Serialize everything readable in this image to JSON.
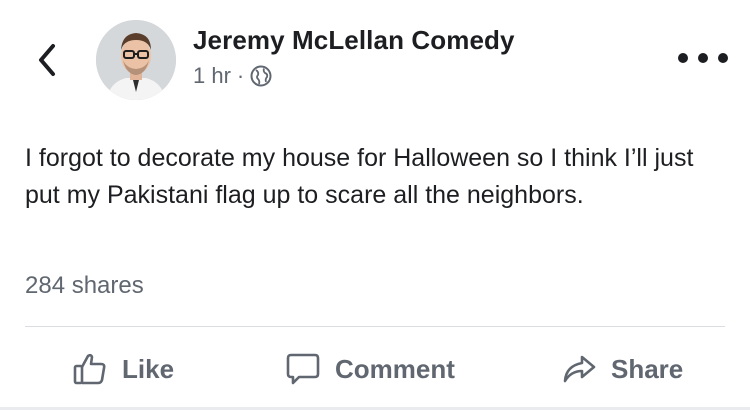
{
  "post": {
    "author": "Jeremy McLellan Comedy",
    "timestamp": "1 hr",
    "separator": "·",
    "audience_icon": "globe-icon",
    "text": "I forgot to decorate my house for Halloween so I think I’ll just put my Pakistani flag up to scare all the neighbors.",
    "shares": "284 shares"
  },
  "actions": {
    "like": "Like",
    "comment": "Comment",
    "share": "Share"
  },
  "icons": {
    "back": "chevron-left-icon",
    "more": "more-horizontal-icon",
    "like": "thumbs-up-icon",
    "comment": "speech-bubble-icon",
    "share": "share-arrow-icon"
  },
  "colors": {
    "text": "#1c1e21",
    "secondary": "#606770",
    "divider": "#dadde1"
  }
}
